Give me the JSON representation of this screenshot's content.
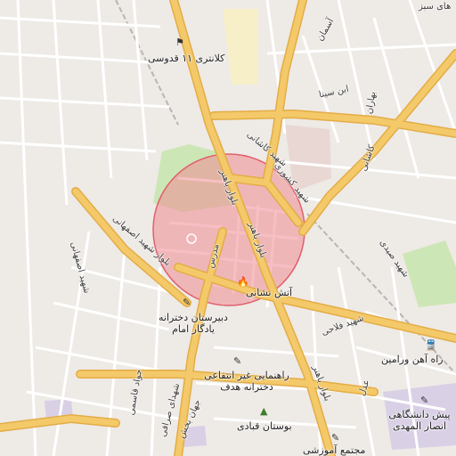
{
  "map": {
    "colors": {
      "background": "#eeeae6",
      "major_road": "#f4c969",
      "major_road_casing": "#e3ad46",
      "minor_road": "#ffffff",
      "park": "#cde6b5",
      "campus": "#d9d0e6",
      "highlight_fill": "#f08a92",
      "highlight_stroke": "#e0606c"
    },
    "labels": {
      "police": "کلانتری ۱۱ قدوسی",
      "ibn_sina": "ابن سینا",
      "asman": "آسمان",
      "sabz": "های سبز",
      "bahar_north": "بهاران",
      "kashani": "کاشانی",
      "shahid_kashani": "شهید کاشانی",
      "shahid_keshvari": "شهید کشوری",
      "blvd_baher_1": "بلوار باهنر",
      "blvd_baher_2": "بلوار باهنر",
      "blvd_baher_3": "بلوار باهنر",
      "modarres": "مدرس",
      "shahid_sayyadi": "شهید صیدی",
      "blvd_shahid_esfahani": "بلوار شهید اصفهانی",
      "shahid_esfahani": "شهید اصفهانی",
      "shahid_fallahi": "شهید فلاحی",
      "fire_station": "آتش نشانی",
      "girls_school": "دبیرستان دخترانه یادگار امام",
      "guidance_school": "راهنمایی غیر انتفاعی دخترانه هدف",
      "railway": "راه آهن ورامین",
      "university": "پیش دانشگاهی انصار المهدی",
      "park_ghobadi": "بوستان قبادی",
      "edu_complex": "مجتمع آموزشی",
      "edalat": "عدل",
      "javad_ghasemi": "جواد قاسمی",
      "shahid_sarrafi": "شهدای صرافی",
      "jahan_bakhsh": "جهان بخش"
    },
    "icons": {
      "police": "police-icon",
      "fire": "fire-icon",
      "school": "school-icon",
      "train": "train-icon",
      "park": "tree-icon"
    }
  }
}
